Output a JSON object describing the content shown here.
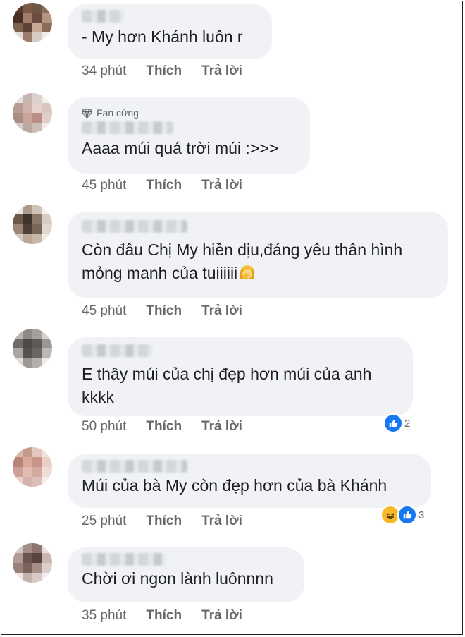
{
  "comments": [
    {
      "text": "- My hơn Khánh luôn r",
      "time": "34 phút",
      "like_label": "Thích",
      "reply_label": "Trả lời",
      "badge": null,
      "reaction_count": null,
      "avatar_colors": [
        "#5a3a2c",
        "#7a5a46",
        "#6e5648",
        "#8d6e5c",
        "#4a2e24",
        "#a07e6a",
        "#6a4d3e",
        "#b59480",
        "#7d6250",
        "#5c4234",
        "#c6a896",
        "#8a6a58",
        "#e6dcd6",
        "#9a7c6a",
        "#d8cbc3",
        "#f2ece8"
      ]
    },
    {
      "text": "Aaaa múi quá trời múi :>>>",
      "time": "45 phút",
      "like_label": "Thích",
      "reply_label": "Trả lời",
      "badge": "Fan cứng",
      "reaction_count": null,
      "avatar_colors": [
        "#e9e2df",
        "#c7b6b0",
        "#dcd0cc",
        "#f3efed",
        "#b79d94",
        "#cfb2a8",
        "#e4d2cb",
        "#d9c8c2",
        "#a98c84",
        "#c8a49a",
        "#b98f86",
        "#e0cfc9",
        "#d7cbc7",
        "#bca8a2",
        "#cdbdb8",
        "#efe8e5"
      ]
    },
    {
      "text": "Còn đâu Chị My hiền dịu,đáng yêu thân hình mỏng manh của tuiiiiii",
      "time": "45 phút",
      "like_label": "Thích",
      "reply_label": "Trả lời",
      "badge": null,
      "reaction_count": null,
      "avatar_colors": [
        "#efe9e4",
        "#a89a8e",
        "#cfc3b8",
        "#f4f0ec",
        "#6c5a4c",
        "#3f342c",
        "#8b7868",
        "#d8cdc2",
        "#9c8676",
        "#4e4038",
        "#7a6658",
        "#e2d8ce",
        "#d5c9be",
        "#b9a898",
        "#c8b8aa",
        "#f0eae5"
      ]
    },
    {
      "text": "E thây múi của chị đẹp hơn múi của anh\nkkkk",
      "time": "50 phút",
      "like_label": "Thích",
      "reply_label": "Trả lời",
      "badge": null,
      "reaction_count": "2",
      "avatar_colors": [
        "#b8b6b2",
        "#8e8a86",
        "#a4a09c",
        "#d6d3cf",
        "#6e6a66",
        "#4d4a47",
        "#5e5a56",
        "#9a9692",
        "#a9a5a1",
        "#55524f",
        "#6a6662",
        "#bcb9b5",
        "#e0dedb",
        "#9c9894",
        "#b4b0ac",
        "#efedeb"
      ]
    },
    {
      "text": "Múi của bà My còn đẹp hơn của bà Khánh",
      "time": "25 phút",
      "like_label": "Thích",
      "reply_label": "Trả lời",
      "badge": null,
      "reaction_count": "3",
      "avatar_colors": [
        "#d9b8ae",
        "#c79a8e",
        "#e3c7bf",
        "#f0e2de",
        "#b98478",
        "#d9a99c",
        "#c89488",
        "#e8d0c9",
        "#caa196",
        "#e2bcb1",
        "#d3aa9e",
        "#efdcd6",
        "#e6d1cb",
        "#d4b4aa",
        "#dcc0b7",
        "#f5ebe8"
      ]
    },
    {
      "text": "Chời ơi ngon lành luônnnn",
      "time": "35 phút",
      "like_label": "Thích",
      "reply_label": "Trả lời",
      "badge": null,
      "reaction_count": null,
      "avatar_colors": [
        "#d4c8c4",
        "#a48e88",
        "#8e7670",
        "#e8dfdc",
        "#b49c96",
        "#6e5650",
        "#5a4440",
        "#c8b6b0",
        "#9a807a",
        "#7c625c",
        "#a88c86",
        "#dccfcb",
        "#ece6e4",
        "#c4b2ac",
        "#d8cac6",
        "#f4efed"
      ]
    }
  ],
  "colors": {
    "bubble": "#f0f2f5",
    "like_blue": "#1877f2",
    "meta_gray": "#65676b"
  }
}
